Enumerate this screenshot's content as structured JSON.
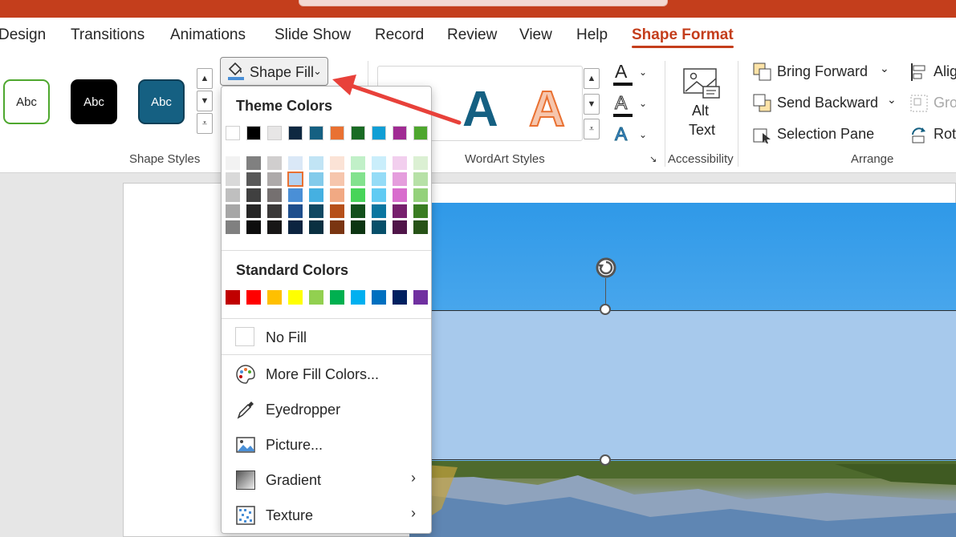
{
  "tabs": [
    "Design",
    "Transitions",
    "Animations",
    "Slide Show",
    "Record",
    "Review",
    "View",
    "Help",
    "Shape Format"
  ],
  "active_tab": "Shape Format",
  "ribbon": {
    "shape_styles": {
      "sample_text": "Abc",
      "group_label": "Shape Styles"
    },
    "shape_fill_label": "Shape Fill",
    "wordart": {
      "letter": "A",
      "group_label": "WordArt Styles"
    },
    "accessibility": {
      "alt_text_line1": "Alt",
      "alt_text_line2": "Text",
      "group_label": "Accessibility"
    },
    "arrange": {
      "bring_forward": "Bring Forward",
      "send_backward": "Send Backward",
      "selection_pane": "Selection Pane",
      "align": "Alig",
      "group": "Gro",
      "rotate": "Rot",
      "group_label": "Arrange"
    }
  },
  "dropdown": {
    "theme_heading": "Theme Colors",
    "standard_heading": "Standard Colors",
    "no_fill": "No Fill",
    "more_colors": "More Fill Colors...",
    "eyedropper": "Eyedropper",
    "picture": "Picture...",
    "gradient": "Gradient",
    "texture": "Texture",
    "theme_base": [
      "#ffffff",
      "#000000",
      "#e7e6e6",
      "#0e2841",
      "#156082",
      "#e97132",
      "#196b24",
      "#0f9ed5",
      "#a02b93",
      "#4ea72e"
    ],
    "theme_tints": [
      [
        "#f2f2f2",
        "#d9d9d9",
        "#bfbfbf",
        "#a6a6a6",
        "#808080"
      ],
      [
        "#808080",
        "#595959",
        "#404040",
        "#262626",
        "#0d0d0d"
      ],
      [
        "#d0cece",
        "#aeaaaa",
        "#757070",
        "#3a3838",
        "#171616"
      ],
      [
        "#dae8f7",
        "#b3d1ef",
        "#4a8fd6",
        "#1e4e8c",
        "#0c2440"
      ],
      [
        "#c1e4f5",
        "#83cbeb",
        "#45b0e1",
        "#104862",
        "#0a3041"
      ],
      [
        "#fbe3d6",
        "#f6c6ad",
        "#f1a983",
        "#b6501a",
        "#7a3511"
      ],
      [
        "#c1f0c8",
        "#83e28e",
        "#47d459",
        "#124f1b",
        "#0c3512"
      ],
      [
        "#caeefb",
        "#95dcf7",
        "#61cbf3",
        "#0b76a0",
        "#074f6a"
      ],
      [
        "#f2cfee",
        "#e59edd",
        "#d86dcd",
        "#77206d",
        "#501549"
      ],
      [
        "#dbf0d3",
        "#b7e1a7",
        "#94d17b",
        "#3a7d22",
        "#275317"
      ]
    ],
    "standard": [
      "#c00000",
      "#ff0000",
      "#ffc000",
      "#ffff00",
      "#92d050",
      "#00b050",
      "#00b0f0",
      "#0070c0",
      "#002060",
      "#7030a0"
    ]
  },
  "colors": {
    "accent": "#c43e1c",
    "annotation_arrow": "#e8413a"
  }
}
